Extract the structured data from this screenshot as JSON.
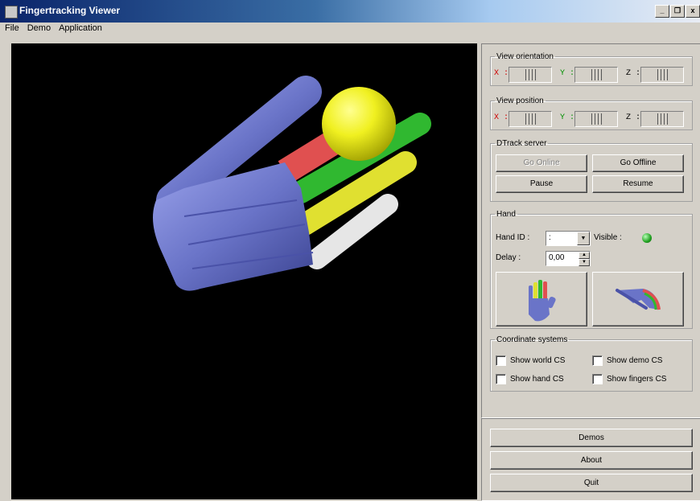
{
  "window": {
    "title": "Fingertracking Viewer",
    "minimize_glyph": "_",
    "restore_glyph": "❐",
    "close_glyph": "x"
  },
  "menu": [
    {
      "label": "File"
    },
    {
      "label": "Demo"
    },
    {
      "label": "Application"
    }
  ],
  "view_orientation": {
    "legend": "View orientation",
    "x_label": "X :",
    "y_label": "Y :",
    "z_label": "Z :"
  },
  "view_position": {
    "legend": "View position",
    "x_label": "X :",
    "y_label": "Y :",
    "z_label": "Z :"
  },
  "dtrack": {
    "legend": "DTrack server",
    "go_online": "Go Online",
    "go_offline": "Go Offline",
    "pause": "Pause",
    "resume": "Resume",
    "go_online_enabled": false
  },
  "hand": {
    "legend": "Hand",
    "hand_id_label": "Hand ID :",
    "hand_id_value": ":",
    "visible_label": "Visible :",
    "visible_state": "on",
    "delay_label": "Delay :",
    "delay_value": "0,00"
  },
  "coordinate_systems": {
    "legend": "Coordinate systems",
    "options": [
      {
        "label": "Show world CS",
        "checked": false
      },
      {
        "label": "Show demo CS",
        "checked": false
      },
      {
        "label": "Show hand CS",
        "checked": false
      },
      {
        "label": "Show fingers CS",
        "checked": false
      }
    ]
  },
  "bottom_buttons": {
    "demos": "Demos",
    "about": "About",
    "quit": "Quit"
  },
  "colors": {
    "axis_x": "#d00000",
    "axis_y": "#009000",
    "hand_blue": "#6a74c8",
    "thumb_tip": "#f0f020",
    "index": "#e85050",
    "middle": "#30c030",
    "ring": "#e0e030",
    "pinky": "#e8e8e8"
  }
}
